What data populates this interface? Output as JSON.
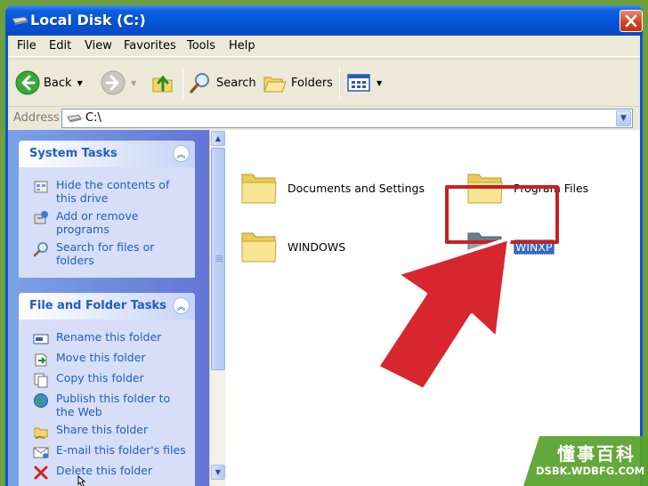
{
  "window": {
    "title": "Local Disk (C:)"
  },
  "menu": [
    "File",
    "Edit",
    "View",
    "Favorites",
    "Tools",
    "Help"
  ],
  "toolbar": {
    "back_label": "Back",
    "search_label": "Search",
    "folders_label": "Folders"
  },
  "address": {
    "label": "Address",
    "value": "C:\\"
  },
  "system_tasks": {
    "title": "System Tasks",
    "items": [
      {
        "label": "Hide the contents of this drive",
        "icon": "hide-contents-icon"
      },
      {
        "label": "Add or remove programs",
        "icon": "add-remove-programs-icon"
      },
      {
        "label": "Search for files or folders",
        "icon": "search-icon"
      }
    ]
  },
  "file_folder_tasks": {
    "title": "File and Folder Tasks",
    "items": [
      {
        "label": "Rename this folder",
        "icon": "rename-icon"
      },
      {
        "label": "Move this folder",
        "icon": "move-icon"
      },
      {
        "label": "Copy this folder",
        "icon": "copy-icon"
      },
      {
        "label": "Publish this folder to the Web",
        "icon": "publish-web-icon"
      },
      {
        "label": "Share this folder",
        "icon": "share-icon"
      },
      {
        "label": "E-mail this folder's files",
        "icon": "email-icon"
      },
      {
        "label": "Delete this folder",
        "icon": "delete-icon"
      }
    ]
  },
  "folders": [
    {
      "name": "Documents and Settings"
    },
    {
      "name": "Program Files"
    },
    {
      "name": "WINDOWS"
    },
    {
      "name": "WINXP",
      "selected": true
    }
  ],
  "watermark": {
    "title": "懂事百科",
    "url": "DSBK.WDBFG.COM"
  },
  "colors": {
    "title_bar": "#0653d6",
    "task_link": "#215dc6",
    "highlight": "#c81f25",
    "arrow": "#d7262d",
    "selection": "#316ac5"
  }
}
